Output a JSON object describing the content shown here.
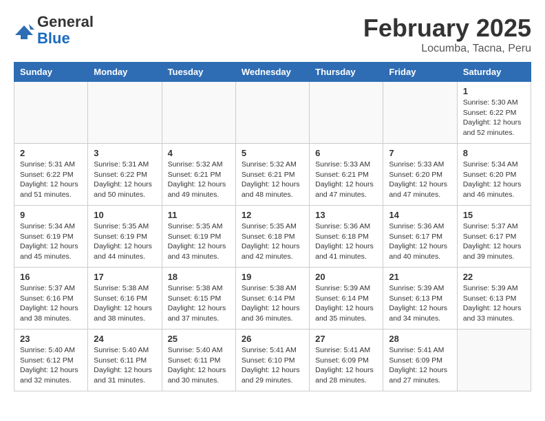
{
  "header": {
    "logo_general": "General",
    "logo_blue": "Blue",
    "month": "February 2025",
    "location": "Locumba, Tacna, Peru"
  },
  "days_of_week": [
    "Sunday",
    "Monday",
    "Tuesday",
    "Wednesday",
    "Thursday",
    "Friday",
    "Saturday"
  ],
  "weeks": [
    [
      {
        "num": "",
        "info": ""
      },
      {
        "num": "",
        "info": ""
      },
      {
        "num": "",
        "info": ""
      },
      {
        "num": "",
        "info": ""
      },
      {
        "num": "",
        "info": ""
      },
      {
        "num": "",
        "info": ""
      },
      {
        "num": "1",
        "info": "Sunrise: 5:30 AM\nSunset: 6:22 PM\nDaylight: 12 hours\nand 52 minutes."
      }
    ],
    [
      {
        "num": "2",
        "info": "Sunrise: 5:31 AM\nSunset: 6:22 PM\nDaylight: 12 hours\nand 51 minutes."
      },
      {
        "num": "3",
        "info": "Sunrise: 5:31 AM\nSunset: 6:22 PM\nDaylight: 12 hours\nand 50 minutes."
      },
      {
        "num": "4",
        "info": "Sunrise: 5:32 AM\nSunset: 6:21 PM\nDaylight: 12 hours\nand 49 minutes."
      },
      {
        "num": "5",
        "info": "Sunrise: 5:32 AM\nSunset: 6:21 PM\nDaylight: 12 hours\nand 48 minutes."
      },
      {
        "num": "6",
        "info": "Sunrise: 5:33 AM\nSunset: 6:21 PM\nDaylight: 12 hours\nand 47 minutes."
      },
      {
        "num": "7",
        "info": "Sunrise: 5:33 AM\nSunset: 6:20 PM\nDaylight: 12 hours\nand 47 minutes."
      },
      {
        "num": "8",
        "info": "Sunrise: 5:34 AM\nSunset: 6:20 PM\nDaylight: 12 hours\nand 46 minutes."
      }
    ],
    [
      {
        "num": "9",
        "info": "Sunrise: 5:34 AM\nSunset: 6:19 PM\nDaylight: 12 hours\nand 45 minutes."
      },
      {
        "num": "10",
        "info": "Sunrise: 5:35 AM\nSunset: 6:19 PM\nDaylight: 12 hours\nand 44 minutes."
      },
      {
        "num": "11",
        "info": "Sunrise: 5:35 AM\nSunset: 6:19 PM\nDaylight: 12 hours\nand 43 minutes."
      },
      {
        "num": "12",
        "info": "Sunrise: 5:35 AM\nSunset: 6:18 PM\nDaylight: 12 hours\nand 42 minutes."
      },
      {
        "num": "13",
        "info": "Sunrise: 5:36 AM\nSunset: 6:18 PM\nDaylight: 12 hours\nand 41 minutes."
      },
      {
        "num": "14",
        "info": "Sunrise: 5:36 AM\nSunset: 6:17 PM\nDaylight: 12 hours\nand 40 minutes."
      },
      {
        "num": "15",
        "info": "Sunrise: 5:37 AM\nSunset: 6:17 PM\nDaylight: 12 hours\nand 39 minutes."
      }
    ],
    [
      {
        "num": "16",
        "info": "Sunrise: 5:37 AM\nSunset: 6:16 PM\nDaylight: 12 hours\nand 38 minutes."
      },
      {
        "num": "17",
        "info": "Sunrise: 5:38 AM\nSunset: 6:16 PM\nDaylight: 12 hours\nand 38 minutes."
      },
      {
        "num": "18",
        "info": "Sunrise: 5:38 AM\nSunset: 6:15 PM\nDaylight: 12 hours\nand 37 minutes."
      },
      {
        "num": "19",
        "info": "Sunrise: 5:38 AM\nSunset: 6:14 PM\nDaylight: 12 hours\nand 36 minutes."
      },
      {
        "num": "20",
        "info": "Sunrise: 5:39 AM\nSunset: 6:14 PM\nDaylight: 12 hours\nand 35 minutes."
      },
      {
        "num": "21",
        "info": "Sunrise: 5:39 AM\nSunset: 6:13 PM\nDaylight: 12 hours\nand 34 minutes."
      },
      {
        "num": "22",
        "info": "Sunrise: 5:39 AM\nSunset: 6:13 PM\nDaylight: 12 hours\nand 33 minutes."
      }
    ],
    [
      {
        "num": "23",
        "info": "Sunrise: 5:40 AM\nSunset: 6:12 PM\nDaylight: 12 hours\nand 32 minutes."
      },
      {
        "num": "24",
        "info": "Sunrise: 5:40 AM\nSunset: 6:11 PM\nDaylight: 12 hours\nand 31 minutes."
      },
      {
        "num": "25",
        "info": "Sunrise: 5:40 AM\nSunset: 6:11 PM\nDaylight: 12 hours\nand 30 minutes."
      },
      {
        "num": "26",
        "info": "Sunrise: 5:41 AM\nSunset: 6:10 PM\nDaylight: 12 hours\nand 29 minutes."
      },
      {
        "num": "27",
        "info": "Sunrise: 5:41 AM\nSunset: 6:09 PM\nDaylight: 12 hours\nand 28 minutes."
      },
      {
        "num": "28",
        "info": "Sunrise: 5:41 AM\nSunset: 6:09 PM\nDaylight: 12 hours\nand 27 minutes."
      },
      {
        "num": "",
        "info": ""
      }
    ]
  ]
}
